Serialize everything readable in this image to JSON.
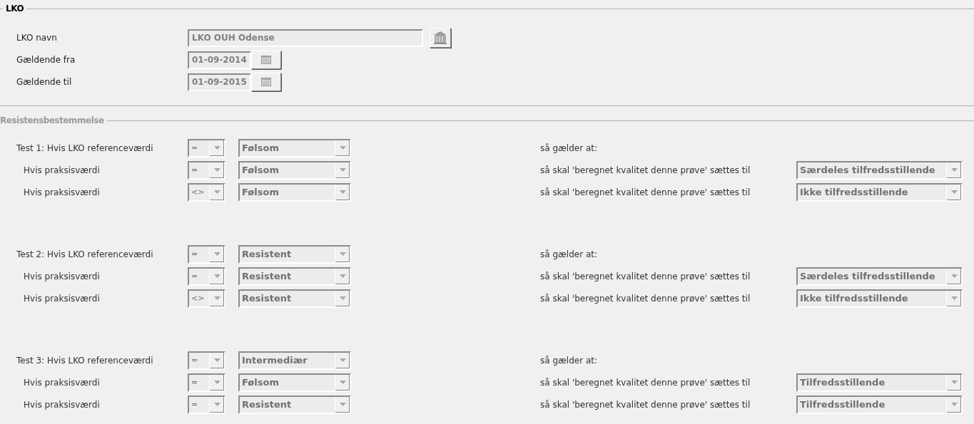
{
  "lko": {
    "title": "LKO",
    "disabled": true,
    "fields": [
      {
        "kind": "text",
        "label": "LKO navn",
        "value": "LKO OUH Odense"
      },
      {
        "kind": "date",
        "label": "Gældende fra",
        "value": "01-09-2014"
      },
      {
        "kind": "date",
        "label": "Gældende til",
        "value": "01-09-2015"
      }
    ]
  },
  "resistens": {
    "title": "Resistensbestemmelse",
    "disabled": true,
    "tests": [
      {
        "rows": [
          {
            "label": "Test 1: Hvis LKO referenceværdi",
            "operator": "=",
            "value": "Følsom",
            "consequence": "så gælder at:"
          },
          {
            "label": "Hvis praksisværdi",
            "operator": "=",
            "value": "Følsom",
            "consequence": "så skal 'beregnet kvalitet denne prøve' sættes til",
            "result": "Særdeles tilfredsstillende"
          },
          {
            "label": "Hvis praksisværdi",
            "operator": "<>",
            "value": "Følsom",
            "consequence": "så skal 'beregnet kvalitet denne prøve' sættes til",
            "result": "Ikke tilfredsstillende"
          }
        ]
      },
      {
        "rows": [
          {
            "label": "Test 2: Hvis LKO referenceværdi",
            "operator": "=",
            "value": "Resistent",
            "consequence": "så gælder at:"
          },
          {
            "label": "Hvis praksisværdi",
            "operator": "=",
            "value": "Resistent",
            "consequence": "så skal 'beregnet kvalitet denne prøve' sættes til",
            "result": "Særdeles tilfredsstillende"
          },
          {
            "label": "Hvis praksisværdi",
            "operator": "<>",
            "value": "Resistent",
            "consequence": "så skal 'beregnet kvalitet denne prøve' sættes til",
            "result": "Ikke tilfredsstillende"
          }
        ]
      },
      {
        "rows": [
          {
            "label": "Test 3: Hvis LKO referenceværdi",
            "operator": "=",
            "value": "Intermediær",
            "consequence": "så gælder at:"
          },
          {
            "label": "Hvis praksisværdi",
            "operator": "=",
            "value": "Følsom",
            "consequence": "så skal 'beregnet kvalitet denne prøve' sættes til",
            "result": "Tilfredsstillende"
          },
          {
            "label": "Hvis praksisværdi",
            "operator": "=",
            "value": "Resistent",
            "consequence": "så skal 'beregnet kvalitet denne prøve' sættes til",
            "result": "Tilfredsstillende"
          }
        ]
      }
    ]
  }
}
